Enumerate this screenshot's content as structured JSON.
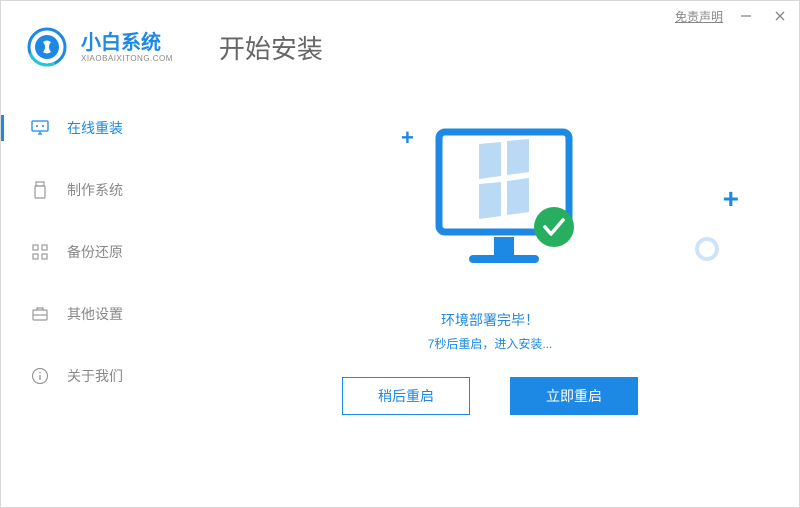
{
  "titlebar": {
    "disclaimer": "免责声明"
  },
  "brand": {
    "name": "小白系统",
    "sub": "XIAOBAIXITONG.COM"
  },
  "page_title": "开始安装",
  "sidebar": {
    "items": [
      {
        "label": "在线重装"
      },
      {
        "label": "制作系统"
      },
      {
        "label": "备份还原"
      },
      {
        "label": "其他设置"
      },
      {
        "label": "关于我们"
      }
    ]
  },
  "main": {
    "status": "环境部署完毕！",
    "substatus": "7秒后重启，进入安装...",
    "btn_later": "稍后重启",
    "btn_now": "立即重启"
  }
}
